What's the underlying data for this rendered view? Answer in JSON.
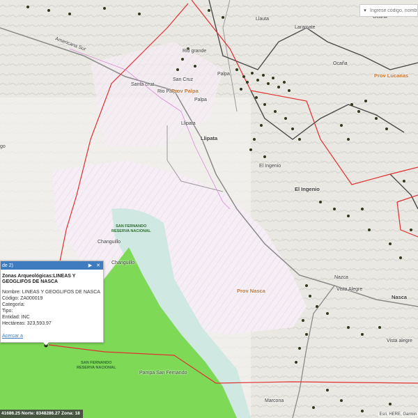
{
  "search": {
    "placeholder": "Ingrese código, nombre",
    "caret": "▾"
  },
  "places": [
    {
      "name": "Llauta",
      "cls": ""
    },
    {
      "name": "Laramate",
      "cls": ""
    },
    {
      "name": "Ocana",
      "cls": ""
    },
    {
      "name": "Ocaña",
      "cls": ""
    },
    {
      "name": "Rio grande",
      "cls": ""
    },
    {
      "name": "Palpa",
      "cls": ""
    },
    {
      "name": "Santa cruz",
      "cls": ""
    },
    {
      "name": "San Cruz",
      "cls": ""
    },
    {
      "name": "Rio Palpa",
      "cls": ""
    },
    {
      "name": "Palpa",
      "cls": ""
    },
    {
      "name": "Llipata",
      "cls": ""
    },
    {
      "name": "Llipata",
      "cls": "bold"
    },
    {
      "name": "El Ingenio",
      "cls": ""
    },
    {
      "name": "El Ingenio",
      "cls": "bold"
    },
    {
      "name": "Changuillo",
      "cls": ""
    },
    {
      "name": "Changuillo",
      "cls": ""
    },
    {
      "name": "Nazca",
      "cls": ""
    },
    {
      "name": "Vista Alegre",
      "cls": ""
    },
    {
      "name": "Nasca",
      "cls": "bold"
    },
    {
      "name": "Vista alegre",
      "cls": ""
    },
    {
      "name": "Marcona",
      "cls": ""
    },
    {
      "name": "Pampa San Fernando",
      "cls": ""
    },
    {
      "name": "Americana Sur",
      "cls": ""
    },
    {
      "name": "go",
      "cls": ""
    }
  ],
  "provinces": [
    "Prov Palpa",
    "Prov Lucanas",
    "Prov Nasca"
  ],
  "reserves": [
    {
      "line1": "SAN FERNANDO",
      "line2": "RESERVA NACIONAL"
    },
    {
      "line1": "SAN FERNANDO",
      "line2": "RESERVA NACIONAL"
    }
  ],
  "popup": {
    "header": "de 2)",
    "next": "▶",
    "close": "✕",
    "title": "Zonas Arqueológicas:LINEAS Y GEOGLIFOS DE NASCA",
    "rows": [
      "Nombre: LINEAS Y GEOGLIFOS DE NASCA",
      "Código: ZA000019",
      "Categoría:",
      "Tipo:",
      "Entidad: INC",
      "Hectáreas: 323,593.97"
    ],
    "zoom": "Acercar a"
  },
  "coords": "41686.25 Norte: 8348286.27 Zona: 18",
  "attribution": "Esri, HERE, Garmin",
  "colors": {
    "boundary": "#e03030",
    "reserve_green": "#7ed957",
    "reserve_blue": "#cfe8e2",
    "road": "#8a8a8a",
    "district": "#555"
  }
}
